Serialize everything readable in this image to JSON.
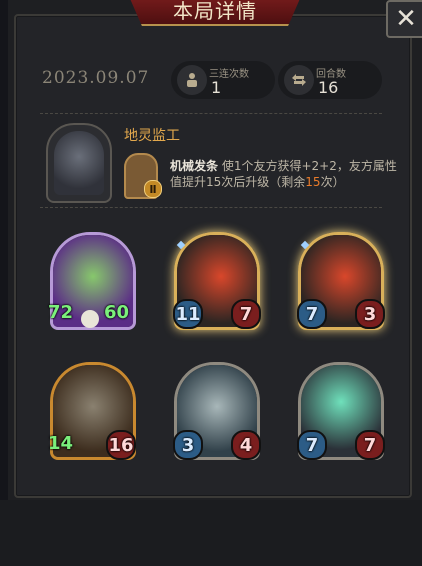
{
  "window": {
    "title": "本局详情",
    "close_glyph": "✕"
  },
  "match": {
    "date": "2023.09.07",
    "stats": [
      {
        "label": "三连次数",
        "value": "1",
        "icon": "pawn-icon"
      },
      {
        "label": "回合数",
        "value": "16",
        "icon": "cycle-icon"
      }
    ]
  },
  "hero": {
    "name": "地灵监工",
    "tower_level": "Ⅱ",
    "ability": {
      "name": "机械发条",
      "text_before": "使1个友方获得+2+2，友方属性值提升15次后升级（剩余",
      "remaining": "15",
      "text_after": "次）"
    }
  },
  "cards": [
    {
      "atk": "72",
      "hp": "60",
      "style": "purple"
    },
    {
      "atk": "11",
      "hp": "7",
      "style": "gold"
    },
    {
      "atk": "7",
      "hp": "3",
      "style": "gold"
    },
    {
      "atk": "14",
      "hp": "16",
      "style": "bronze"
    },
    {
      "atk": "3",
      "hp": "4",
      "style": "steel"
    },
    {
      "atk": "7",
      "hp": "7",
      "style": "steel"
    }
  ],
  "colors": {
    "accent_gold": "#e2a84d",
    "highlight_orange": "#e97b2b",
    "banner_red": "#7a1d1d"
  }
}
